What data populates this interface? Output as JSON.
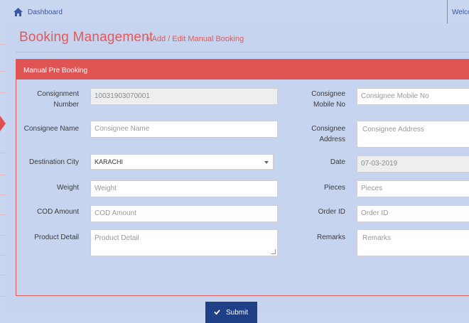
{
  "topbar": {
    "breadcrumb": "Dashboard",
    "welcome": "Welco"
  },
  "header": {
    "title": "Booking Management",
    "subtitle": "» Add / Edit Manual Booking"
  },
  "card": {
    "title": "Manual Pre Booking"
  },
  "form": {
    "consignment_number": {
      "label": "Consignment Number",
      "value": "10031903070001"
    },
    "consignee_mobile": {
      "label": "Consignee Mobile No",
      "placeholder": "Consignee Mobile No"
    },
    "consignee_name": {
      "label": "Consignee Name",
      "placeholder": "Consignee Name"
    },
    "consignee_address": {
      "label": "Consignee Address",
      "placeholder": "Consignee Address"
    },
    "destination_city": {
      "label": "Destination City",
      "value": "KARACHI"
    },
    "date": {
      "label": "Date",
      "value": "07-03-2019"
    },
    "weight": {
      "label": "Weight",
      "placeholder": "Weight"
    },
    "pieces": {
      "label": "Pieces",
      "placeholder": "Pieces"
    },
    "cod_amount": {
      "label": "COD Amount",
      "placeholder": "COD Amount"
    },
    "order_id": {
      "label": "Order ID",
      "placeholder": "Order ID"
    },
    "product_detail": {
      "label": "Product Detail",
      "placeholder": "Product Detail"
    },
    "remarks": {
      "label": "Remarks",
      "placeholder": "Remarks"
    }
  },
  "submit_label": "Submit",
  "colors": {
    "accent": "#e05353",
    "button": "#1f3f86",
    "background": "#c9d6f0"
  }
}
